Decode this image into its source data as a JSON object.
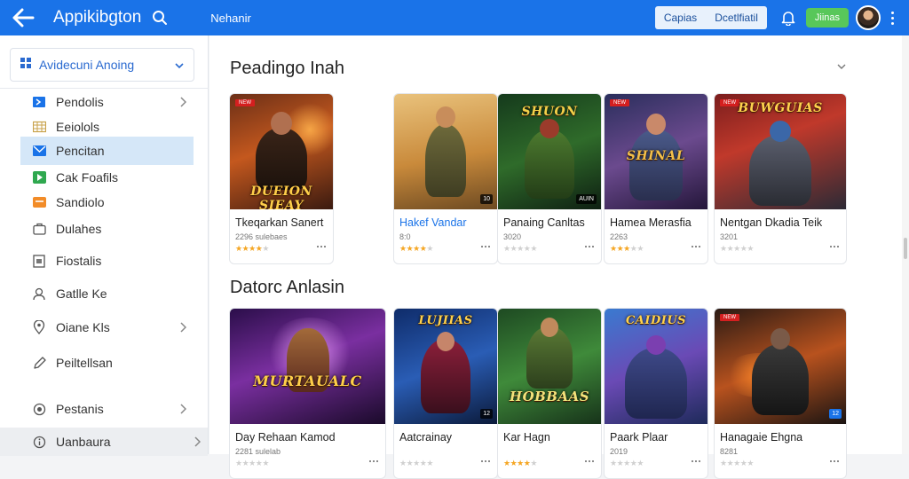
{
  "topbar": {
    "title": "Appikibgton",
    "link": "Nehanir",
    "pill_left": "Capias",
    "pill_right": "Dcetlfiatil",
    "green_button": "Jiinas"
  },
  "sidebar": {
    "select_label": "Avidecuni Anoing",
    "items": [
      {
        "label": "Pendolis",
        "icon": "flag-icon"
      },
      {
        "label": "Eeiolols",
        "icon": "grid-icon"
      },
      {
        "label": "Pencitan",
        "icon": "mail-icon"
      },
      {
        "label": "Cak Foafils",
        "icon": "play-icon"
      },
      {
        "label": "Sandiolo",
        "icon": "package-icon"
      },
      {
        "label": "Dulahes",
        "icon": "briefcase-icon"
      },
      {
        "label": "Fiostalis",
        "icon": "document-icon"
      },
      {
        "label": "Gatlle Ke",
        "icon": "user-group-icon"
      },
      {
        "label": "Oiane Kls",
        "icon": "location-icon"
      },
      {
        "label": "Peiltellsan",
        "icon": "pen-icon"
      },
      {
        "label": "Pestanis",
        "icon": "target-icon"
      },
      {
        "label": "Uanbaura",
        "icon": "info-icon"
      }
    ]
  },
  "sections": [
    {
      "title": "Peadingo Inah",
      "cards": [
        {
          "name": "Tkeqarkan Sanert",
          "meta": "2296 sulebaes",
          "rating": 4,
          "logo": "DUEION SIEAY",
          "tag": "NEW",
          "badge": ""
        },
        {
          "name": "Hakef Vandar",
          "meta": "8:0",
          "rating": 4,
          "logo": "",
          "tag": "",
          "badge": "10"
        },
        {
          "name": "Panaing Canltas",
          "meta": "3020",
          "rating": 0,
          "logo": "SHUON",
          "tag": "",
          "badge": "AUIN"
        },
        {
          "name": "Hamea Merasfia",
          "meta": "2263",
          "rating": 3,
          "logo": "SHINAL",
          "tag": "NEW",
          "badge": ""
        },
        {
          "name": "Nentgan Dkadia Teik",
          "meta": "3201",
          "rating": 0,
          "logo": "BUWGUIAS",
          "tag": "NEW",
          "badge": ""
        }
      ]
    },
    {
      "title": "Datorc Anlasin",
      "cards": [
        {
          "name": "Day Rehaan Kamod",
          "meta": "2281 sulelab",
          "rating": 0,
          "logo": "MURTAUALC",
          "tag": "",
          "badge": ""
        },
        {
          "name": "Aatcrainay",
          "meta": "",
          "rating": 0,
          "logo": "LUJIIAS",
          "tag": "",
          "badge": "12"
        },
        {
          "name": "Kar Hagn",
          "meta": "",
          "rating": 4,
          "logo": "HOBBAAS",
          "tag": "",
          "badge": ""
        },
        {
          "name": "Paark Plaar",
          "meta": "2019",
          "rating": 0,
          "logo": "CAIDIUS",
          "tag": "",
          "badge": ""
        },
        {
          "name": "Hanagaie Ehgna",
          "meta": "8281",
          "rating": 0,
          "logo": "",
          "tag": "NEW",
          "badge": "12"
        }
      ]
    }
  ],
  "colors": {
    "brand": "#1a73e8",
    "accent_green": "#58c75a",
    "sidebar_active": "#d5e7f8",
    "star": "#f5a623"
  }
}
